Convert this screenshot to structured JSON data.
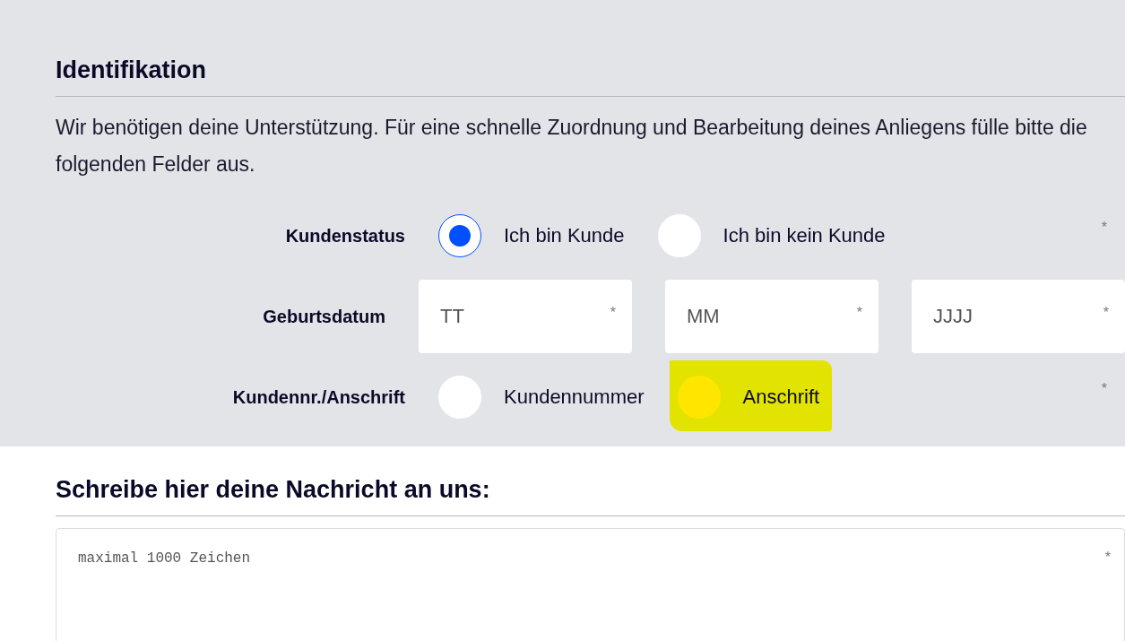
{
  "identification": {
    "heading": "Identifikation",
    "intro": "Wir benötigen deine Unterstützung. Für eine schnelle Zuordnung und Bearbeitung deines Anliegens fülle bitte die folgenden Felder aus.",
    "rows": [
      {
        "kind": "radio",
        "label": "Kundenstatus",
        "required_mark": "*",
        "options": [
          {
            "label": "Ich bin Kunde",
            "selected": true,
            "highlighted": false
          },
          {
            "label": "Ich bin kein Kunde",
            "selected": false,
            "highlighted": false
          }
        ]
      },
      {
        "kind": "date",
        "label": "Geburtsdatum",
        "fields": [
          {
            "placeholder": "TT",
            "required_mark": "*"
          },
          {
            "placeholder": "MM",
            "required_mark": "*"
          },
          {
            "placeholder": "JJJJ",
            "required_mark": "*"
          }
        ]
      },
      {
        "kind": "radio",
        "label": "Kundennr./Anschrift",
        "required_mark": "*",
        "options": [
          {
            "label": "Kundennummer",
            "selected": false,
            "highlighted": false
          },
          {
            "label": "Anschrift",
            "selected": false,
            "highlighted": true
          }
        ]
      }
    ]
  },
  "message": {
    "heading": "Schreibe hier deine Nachricht an uns:",
    "textarea": {
      "placeholder": "maximal 1000 Zeichen",
      "required_mark": "*"
    }
  }
}
